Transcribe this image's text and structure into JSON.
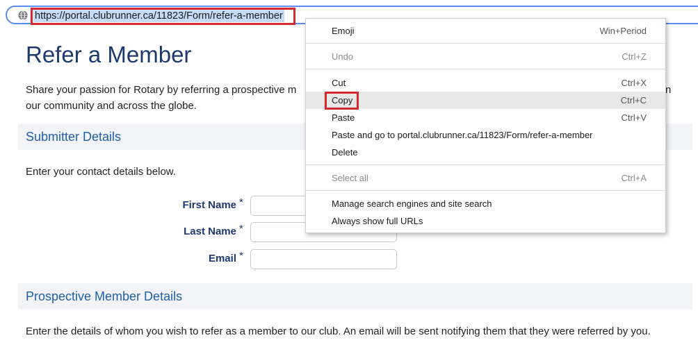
{
  "browser": {
    "url": "https://portal.clubrunner.ca/11823/Form/refer-a-member",
    "site_icon": "globe-icon"
  },
  "page": {
    "title": "Refer a Member",
    "intro_line1": "Share your passion for Rotary by referring a prospective m",
    "intro_tail": "n",
    "intro_line2": "our community and across the globe.",
    "submitter_section": {
      "title": "Submitter Details",
      "description": "Enter your contact details below.",
      "fields": [
        {
          "label": "First Name",
          "required_mark": "*",
          "value": ""
        },
        {
          "label": "Last Name",
          "required_mark": "*",
          "value": ""
        },
        {
          "label": "Email",
          "required_mark": "*",
          "value": ""
        }
      ]
    },
    "prospective_section": {
      "title": "Prospective Member Details",
      "description": "Enter the details of whom you wish to refer as a member to our club. An email will be sent notifying them that they were referred by you."
    }
  },
  "context_menu": {
    "items": [
      {
        "label": "Emoji",
        "shortcut": "Win+Period"
      },
      {
        "label": "Undo",
        "shortcut": "Ctrl+Z",
        "disabled": true
      },
      {
        "label": "Cut",
        "shortcut": "Ctrl+X"
      },
      {
        "label": "Copy",
        "shortcut": "Ctrl+C",
        "hover": true
      },
      {
        "label": "Paste",
        "shortcut": "Ctrl+V"
      },
      {
        "label": "Paste and go to portal.clubrunner.ca/11823/Form/refer-a-member",
        "shortcut": ""
      },
      {
        "label": "Delete",
        "shortcut": ""
      },
      {
        "label": "Select all",
        "shortcut": "Ctrl+A",
        "disabled": true
      },
      {
        "label": "Manage search engines and site search",
        "shortcut": ""
      },
      {
        "label": "Always show full URLs",
        "shortcut": ""
      }
    ]
  },
  "colors": {
    "highlight_box": "#d7272f",
    "heading": "#1d3a6e",
    "section_title": "#1f5fa6",
    "section_bg": "#f1f3f6"
  }
}
